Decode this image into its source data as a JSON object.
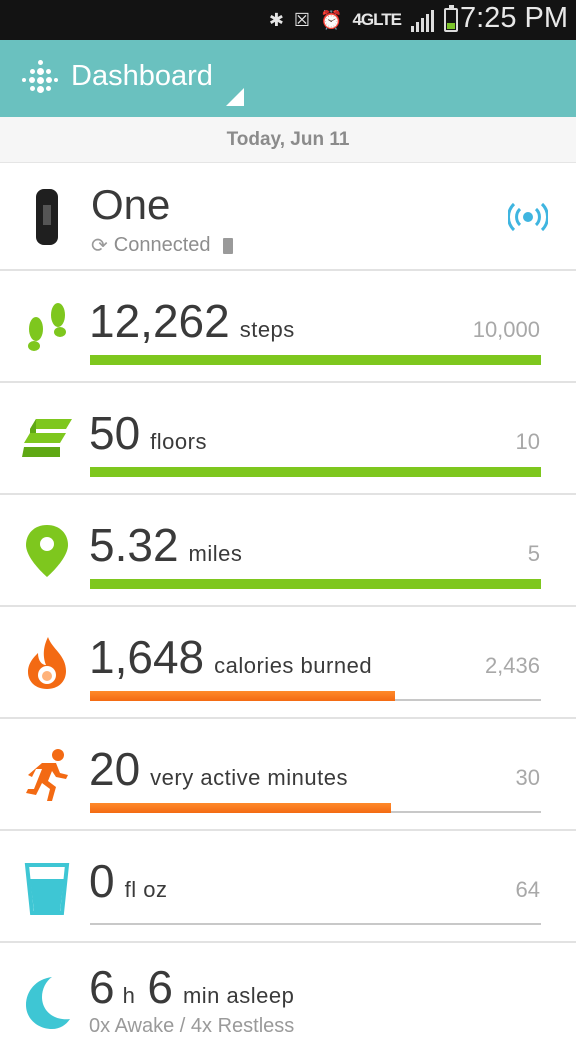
{
  "status_bar": {
    "time": "7:25 PM",
    "network": "4GLTE",
    "icons": [
      "bluetooth-icon",
      "mute-icon",
      "alarm-icon",
      "signal-icon",
      "battery-icon"
    ]
  },
  "app_bar": {
    "title": "Dashboard"
  },
  "date": "Today, Jun 11",
  "device": {
    "name": "One",
    "status": "Connected"
  },
  "stats": {
    "steps": {
      "value": "12,262",
      "unit": "steps",
      "goal": "10,000",
      "progress": 1.0,
      "color": "#7ec71e"
    },
    "floors": {
      "value": "50",
      "unit": "floors",
      "goal": "10",
      "progress": 1.0,
      "color": "#7ec71e"
    },
    "distance": {
      "value": "5.32",
      "unit": "miles",
      "goal": "5",
      "progress": 1.0,
      "color": "#7ec71e"
    },
    "calories": {
      "value": "1,648",
      "unit": "calories burned",
      "goal": "2,436",
      "progress": 0.677,
      "color": "#f36a13"
    },
    "active": {
      "value": "20",
      "unit": "very active minutes",
      "goal": "30",
      "progress": 0.667,
      "color": "#f36a13"
    },
    "water": {
      "value": "0",
      "unit": "fl oz",
      "goal": "64",
      "progress": 0
    }
  },
  "sleep": {
    "hours": "6",
    "hours_unit": "h",
    "minutes": "6",
    "minutes_unit": "min asleep",
    "detail": "0x Awake / 4x Restless"
  }
}
